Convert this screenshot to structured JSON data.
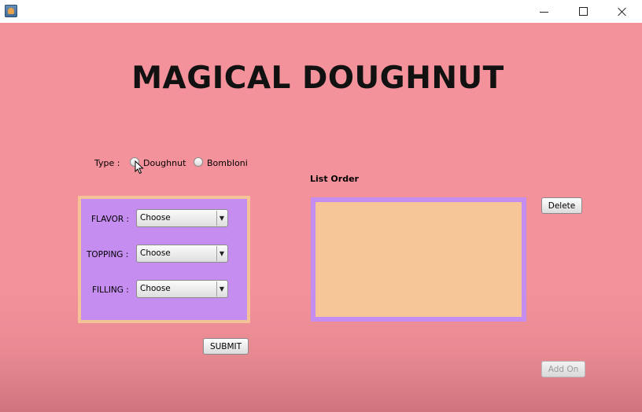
{
  "window": {
    "minimize_glyph": "",
    "maximize_glyph": "",
    "close_glyph": ""
  },
  "title": "MAGICAL DOUGHNUT",
  "type": {
    "label": "Type :",
    "options": [
      "Doughnut",
      "Bombloni"
    ],
    "selected": null
  },
  "options_panel": {
    "flavor_label": "FLAVOR :",
    "flavor_value": "Choose",
    "topping_label": "TOPPING :",
    "topping_value": "Choose",
    "filling_label": "FILLING :",
    "filling_value": "Choose"
  },
  "list_order": {
    "label": "List Order",
    "items": []
  },
  "buttons": {
    "delete": "Delete",
    "submit": "SUBMIT",
    "add_on": "Add On"
  },
  "colors": {
    "background": "#f4929b",
    "options_panel": "#c58df0",
    "options_border": "#f5c197",
    "list_fill": "#f6c598",
    "list_border": "#c58df0"
  }
}
